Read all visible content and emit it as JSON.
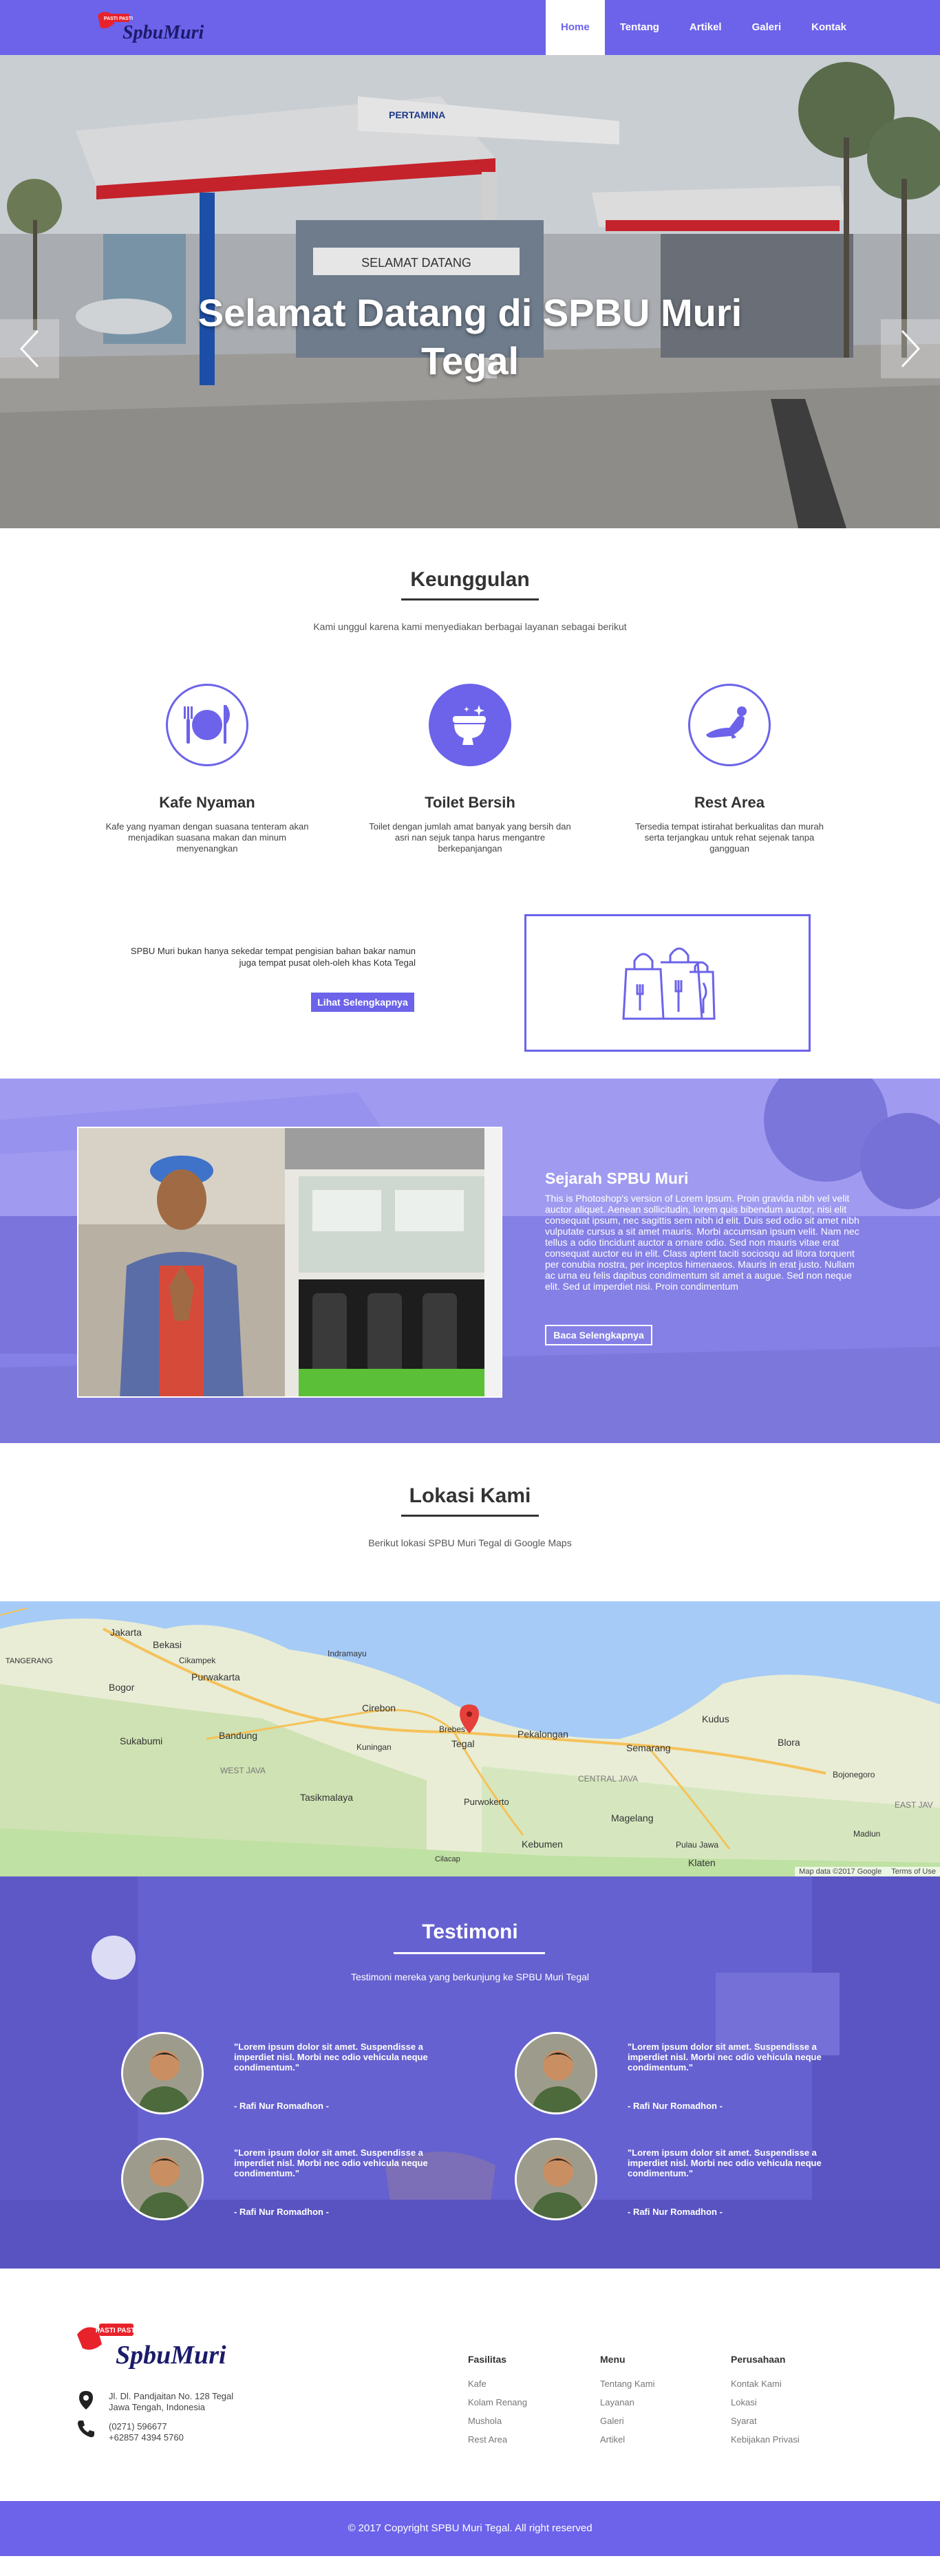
{
  "brand": {
    "logo_script": "SpbuMuri",
    "logo_badge": "PASTI PASTI",
    "accent": "#6c63ea"
  },
  "nav": {
    "items": [
      {
        "label": "Home",
        "active": true
      },
      {
        "label": "Tentang"
      },
      {
        "label": "Artikel"
      },
      {
        "label": "Galeri"
      },
      {
        "label": "Kontak"
      }
    ]
  },
  "hero": {
    "title": "Selamat Datang di SPBU Muri Tegal",
    "sign_brand": "PERTAMINA",
    "sign_welcome": "SELAMAT DATANG",
    "prev_icon": "chevron-left-icon",
    "next_icon": "chevron-right-icon",
    "slides": 3,
    "active_slide": 2
  },
  "features": {
    "title": "Keunggulan",
    "subtitle": "Kami unggul karena kami menyediakan berbagai layanan sebagai berikut",
    "items": [
      {
        "icon": "dining-icon",
        "title": "Kafe Nyaman",
        "text": "Kafe yang nyaman dengan suasana tenteram akan menjadikan suasana makan dan minum menyenangkan"
      },
      {
        "icon": "toilet-icon",
        "title": "Toilet Bersih",
        "text": "Toilet dengan jumlah amat banyak yang bersih dan asri nan sejuk tanpa harus mengantre berkepanjangan"
      },
      {
        "icon": "rest-icon",
        "title": "Rest Area",
        "text": "Tersedia tempat istirahat berkualitas dan murah serta terjangkau untuk rehat sejenak tanpa gangguan"
      }
    ],
    "promo_text": "SPBU Muri bukan hanya sekedar tempat pengisian bahan bakar namun juga tempat pusat oleh-oleh khas Kota Tegal",
    "promo_button": "Lihat Selengkapnya",
    "promo_icon": "shopping-bags-icon"
  },
  "history": {
    "title": "Sejarah SPBU Muri",
    "text": "This is Photoshop's version  of Lorem Ipsum. Proin gravida nibh vel velit auctor aliquet. Aenean sollicitudin, lorem quis bibendum auctor, nisi elit consequat ipsum, nec sagittis sem nibh id elit. Duis sed odio sit amet nibh vulputate cursus a sit amet mauris. Morbi accumsan ipsum velit. Nam nec tellus a odio tincidunt auctor a ornare odio. Sed non  mauris vitae erat consequat auctor eu in elit. Class aptent taciti sociosqu ad litora torquent per conubia nostra, per inceptos himenaeos. Mauris in erat justo. Nullam ac urna eu felis dapibus condimentum sit amet a augue. Sed non neque elit. Sed ut imperdiet nisi. Proin condimentum",
    "button": "Baca Selengkapnya"
  },
  "location": {
    "title": "Lokasi Kami",
    "subtitle": "Berikut lokasi SPBU Muri Tegal di Google Maps",
    "map_labels": {
      "jakarta": "Jakarta",
      "bekasi": "Bekasi",
      "bogor": "Bogor",
      "cikampek": "Cikampek",
      "purwakarta": "Purwakarta",
      "indramayu": "Indramayu",
      "bandung": "Bandung",
      "cirebon": "Cirebon",
      "brebes": "Brebes",
      "tegal": "Tegal",
      "pekalongan": "Pekalongan",
      "semarang": "Semarang",
      "kudus": "Kudus",
      "blora": "Blora",
      "sukabumi": "Sukabumi",
      "west_java": "WEST JAVA",
      "central_java": "CENTRAL JAVA",
      "tasikmalaya": "Tasikmalaya",
      "purwokerto": "Purwokerto",
      "magelang": "Magelang",
      "kebumen": "Kebumen",
      "klaten": "Klaten",
      "madiun": "Madiun",
      "east_java": "EAST JAV",
      "bojonegoro": "Bojonegoro",
      "tangerang": "TANGERANG",
      "kuningan": "Kuningan",
      "pulau_jawa": "Pulau Jawa",
      "cilacap": "Cilacap"
    },
    "map_credit": "Map data ©2017 Google",
    "map_terms": "Terms of Use"
  },
  "testimonials": {
    "title": "Testimoni",
    "subtitle": "Testimoni mereka yang berkunjung ke SPBU Muri Tegal",
    "items": [
      {
        "quote": "\"Lorem ipsum dolor sit amet. Suspendisse a imperdiet nisl.  Morbi nec odio vehicula neque condimentum.\"",
        "name": "- Rafi Nur Romadhon -"
      },
      {
        "quote": "\"Lorem ipsum dolor sit amet. Suspendisse a imperdiet nisl.  Morbi nec odio vehicula neque condimentum.\"",
        "name": "- Rafi Nur Romadhon -"
      },
      {
        "quote": "\"Lorem ipsum dolor sit amet. Suspendisse a imperdiet nisl.  Morbi nec odio vehicula neque condimentum.\"",
        "name": "- Rafi Nur Romadhon -"
      },
      {
        "quote": "\"Lorem ipsum dolor sit amet. Suspendisse a imperdiet nisl.  Morbi nec odio vehicula neque condimentum.\"",
        "name": "- Rafi Nur Romadhon -"
      }
    ]
  },
  "footer": {
    "address_line1": "Jl. Dl. Pandjaitan No. 128 Tegal",
    "address_line2": "Jawa Tengah, Indonesia",
    "phone_line1": "(0271) 596677",
    "phone_line2": "+62857 4394 5760",
    "columns": [
      {
        "title": "Fasilitas",
        "links": [
          "Kafe",
          "Kolam Renang",
          "Mushola",
          "Rest Area"
        ]
      },
      {
        "title": "Menu",
        "links": [
          "Tentang Kami",
          "Layanan",
          "Galeri",
          "Artikel"
        ]
      },
      {
        "title": "Perusahaan",
        "links": [
          "Kontak Kami",
          "Lokasi",
          "Syarat",
          "Kebijakan Privasi"
        ]
      }
    ],
    "copyright": "©  2017 Copyright SPBU Muri Tegal. All right reserved"
  }
}
